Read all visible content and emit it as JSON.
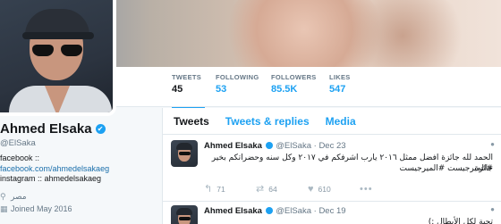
{
  "profile": {
    "name": "Ahmed Elsaka",
    "handle": "@ElSaka",
    "bio_line1": "facebook ::",
    "bio_link": "facebook.com/ahmedelsakaeg",
    "bio_line3": "instagram :: ahmedelsakaeg",
    "location": "مصر",
    "joined": "Joined May 2016",
    "verified_glyph": "✔"
  },
  "stats": [
    {
      "label": "TWEETS",
      "value": "45"
    },
    {
      "label": "FOLLOWING",
      "value": "53"
    },
    {
      "label": "FOLLOWERS",
      "value": "85.5K"
    },
    {
      "label": "LIKES",
      "value": "547"
    }
  ],
  "tabs": [
    "Tweets",
    "Tweets & replies",
    "Media"
  ],
  "tweets": [
    {
      "name": "Ahmed Elsaka",
      "handle": "@ElSaka",
      "date": "Dec 23",
      "text": "الحمد لله جائزة افضل ممثل ٢٠١٦ يارب اشرفكم في ٢٠١٧ وكل سنه وحضراتكم بخير جائزة",
      "hashtags": "#الميرجيست #الميرجيست",
      "replies": "71",
      "retweets": "64",
      "likes": "610"
    },
    {
      "name": "Ahmed Elsaka",
      "handle": "@ElSaka",
      "date": "Dec 19",
      "text": "تحية لكل الأبطال :)"
    }
  ],
  "colors": {
    "accent": "#1da1f2",
    "verified": "#1da1f2",
    "link": "#1b6fab"
  }
}
